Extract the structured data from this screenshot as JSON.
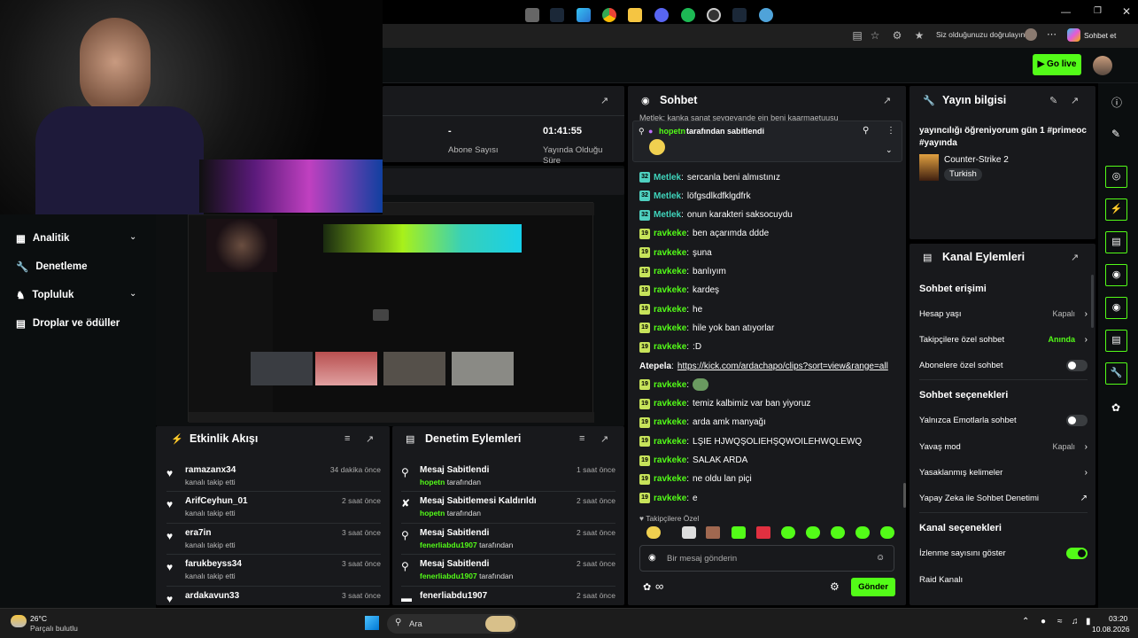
{
  "browser": {
    "identity_prompt": "Siz olduğunuzu doğrulayın",
    "chat_button": "Sohbet et",
    "more": "⋯"
  },
  "header": {
    "go_live": "Go live"
  },
  "sidebar": {
    "items": [
      {
        "label": "Analitik",
        "icon": "chart-icon",
        "chevron": true
      },
      {
        "label": "Denetleme",
        "icon": "wrench-icon",
        "chevron": false
      },
      {
        "label": "Topluluk",
        "icon": "people-icon",
        "chevron": true
      },
      {
        "label": "Droplar ve ödüller",
        "icon": "gift-icon",
        "chevron": false
      }
    ]
  },
  "stats": {
    "subs_value": "-",
    "subs_label": "Abone Sayısı",
    "time_value": "01:41:55",
    "time_label": "Yayında Olduğu Süre"
  },
  "activity": {
    "title": "Etkinlik Akışı",
    "items": [
      {
        "name": "ramazanx34",
        "sub": "kanalı takip etti",
        "time": "34 dakika önce"
      },
      {
        "name": "ArifCeyhun_01",
        "sub": "kanalı takip etti",
        "time": "2 saat önce"
      },
      {
        "name": "era7in",
        "sub": "kanalı takip etti",
        "time": "3 saat önce"
      },
      {
        "name": "farukbeyss34",
        "sub": "kanalı takip etti",
        "time": "3 saat önce"
      },
      {
        "name": "ardakavun33",
        "sub": "",
        "time": "3 saat önce"
      }
    ]
  },
  "moderation": {
    "title": "Denetim Eylemleri",
    "items": [
      {
        "name": "Mesaj Sabitlendi",
        "user": "hopetn",
        "suffix": "tarafından",
        "time": "1 saat önce"
      },
      {
        "name": "Mesaj Sabitlemesi Kaldırıldı",
        "user": "hopetn",
        "suffix": "tarafından",
        "time": "2 saat önce"
      },
      {
        "name": "Mesaj Sabitlendi",
        "user": "fenerliabdu1907",
        "suffix": "tarafından",
        "time": "2 saat önce"
      },
      {
        "name": "Mesaj Sabitlendi",
        "user": "fenerliabdu1907",
        "suffix": "tarafından",
        "time": "2 saat önce"
      },
      {
        "name": "fenerliabdu1907",
        "user": "",
        "suffix": "",
        "time": "2 saat önce"
      }
    ]
  },
  "chat": {
    "title": "Sohbet",
    "partial_top": "Metlek: kanka sanat sevgeyande ein beni kaarmaetuusu",
    "pinned": {
      "user": "hopetn",
      "text": "tarafından sabitlendi"
    },
    "messages": [
      {
        "badge": "32",
        "user": "Metlek",
        "text": "sercanla beni almıstınız",
        "color": "teal"
      },
      {
        "badge": "32",
        "user": "Metlek",
        "text": "löfgsdlkdfklgdfrk",
        "color": "teal"
      },
      {
        "badge": "32",
        "user": "Metlek",
        "text": "onun karakteri saksocuydu",
        "color": "teal"
      },
      {
        "badge": "19",
        "user": "ravkeke",
        "text": "ben açarımda ddde",
        "color": "green"
      },
      {
        "badge": "19",
        "user": "ravkeke",
        "text": "şuna",
        "color": "green"
      },
      {
        "badge": "19",
        "user": "ravkeke",
        "text": "banlıyım",
        "color": "green"
      },
      {
        "badge": "19",
        "user": "ravkeke",
        "text": "kardeş",
        "color": "green"
      },
      {
        "badge": "19",
        "user": "ravkeke",
        "text": "he",
        "color": "green"
      },
      {
        "badge": "19",
        "user": "ravkeke",
        "text": "hile yok ban atıyorlar",
        "color": "green"
      },
      {
        "badge": "19",
        "user": "ravkeke",
        "text": ":D",
        "color": "green"
      },
      {
        "badge": "",
        "user": "Atepela",
        "text": "https://kick.com/ardachapo/clips?sort=view&range=all",
        "color": "white"
      },
      {
        "badge": "19",
        "user": "ravkeke",
        "text": "",
        "color": "green",
        "emote": true
      },
      {
        "badge": "19",
        "user": "ravkeke",
        "text": "temiz kalbimiz var ban yiyoruz",
        "color": "green"
      },
      {
        "badge": "19",
        "user": "ravkeke",
        "text": "arda amk manyağı",
        "color": "green"
      },
      {
        "badge": "19",
        "user": "ravkeke",
        "text": "LŞIE HJWQŞOLIEHŞQWOILEHWQLEWQ",
        "color": "green"
      },
      {
        "badge": "19",
        "user": "ravkeke",
        "text": "SALAK ARDA",
        "color": "green"
      },
      {
        "badge": "19",
        "user": "ravkeke",
        "text": "ne oldu lan piçi",
        "color": "green"
      },
      {
        "badge": "19",
        "user": "ravkeke",
        "text": "e",
        "color": "green"
      }
    ],
    "followers_only": "Takipçilere Özel",
    "input_placeholder": "Bir mesaj gönderin",
    "send": "Gönder"
  },
  "stream_info": {
    "title": "Yayın bilgisi",
    "stream_title": "yayıncılığı öğreniyorum gün 1 #primeoc #yayında",
    "game": "Counter-Strike 2",
    "language": "Turkish"
  },
  "channel_actions": {
    "title": "Kanal Eylemleri",
    "chat_access_title": "Sohbet erişimi",
    "account_age": {
      "label": "Hesap yaşı",
      "value": "Kapalı"
    },
    "followers_only": {
      "label": "Takipçilere özel sohbet",
      "value": "Anında"
    },
    "subs_only": {
      "label": "Abonelere özel sohbet"
    },
    "chat_options_title": "Sohbet seçenekleri",
    "emote_only": {
      "label": "Yalnızca Emotlarla sohbet"
    },
    "slow_mode": {
      "label": "Yavaş mod",
      "value": "Kapalı"
    },
    "banned_words": {
      "label": "Yasaklanmış kelimeler"
    },
    "ai_moderation": {
      "label": "Yapay Zeka ile Sohbet Denetimi"
    },
    "channel_options_title": "Kanal seçenekleri",
    "show_viewers": {
      "label": "İzlenme sayısını göster",
      "on": true
    },
    "raid": {
      "label": "Raid Kanalı"
    }
  },
  "taskbar": {
    "weather_temp": "26°C",
    "weather_desc": "Parçalı bulutlu",
    "search": "Ara",
    "time": "03:20",
    "date": "10.08.2026"
  },
  "colors": {
    "accent": "#53fc18",
    "panel": "#18191c",
    "bg": "#0b0e0f"
  }
}
